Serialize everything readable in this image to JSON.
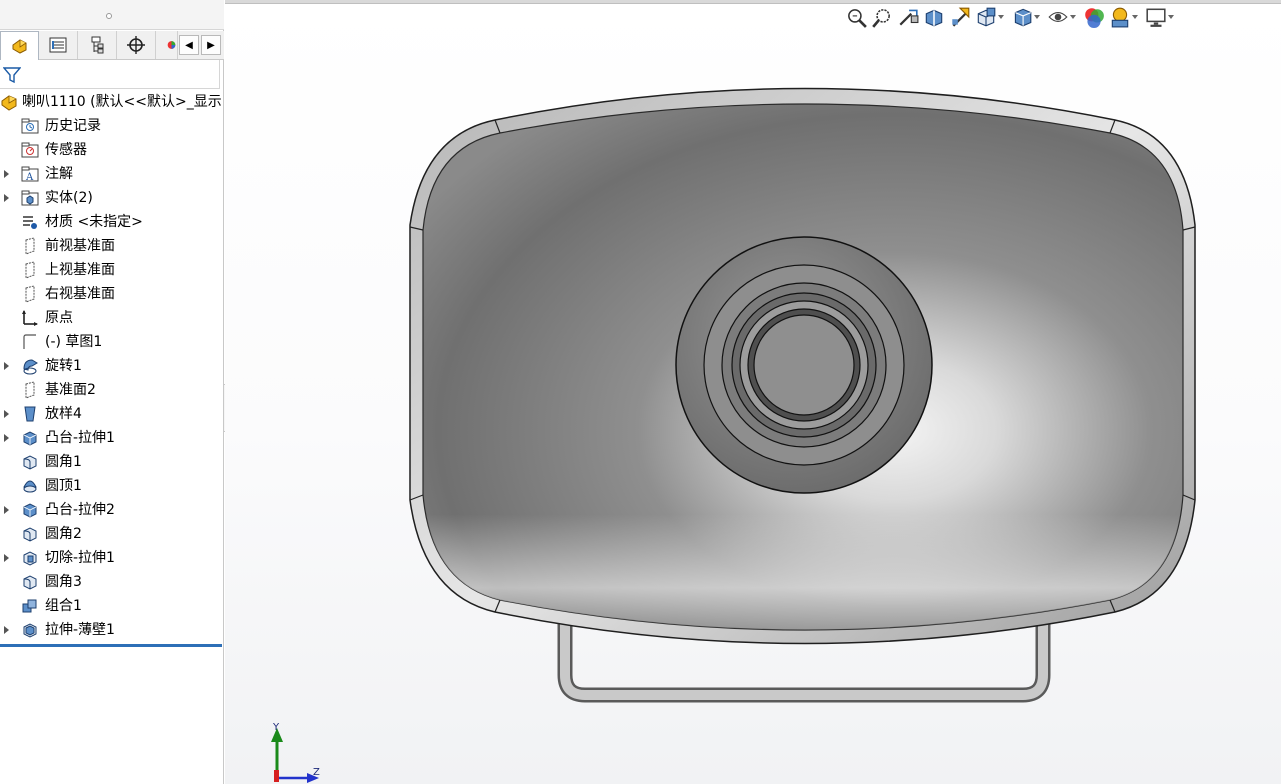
{
  "feature_tree": {
    "root": {
      "label": "喇叭1110 (默认<<默认>_显示",
      "icon": "part-icon"
    },
    "items": [
      {
        "label": "历史记录",
        "icon": "history-folder-icon",
        "expandable": false
      },
      {
        "label": "传感器",
        "icon": "sensor-folder-icon",
        "expandable": false
      },
      {
        "label": "注解",
        "icon": "annotation-folder-icon",
        "expandable": true
      },
      {
        "label": "实体(2)",
        "icon": "solid-bodies-folder-icon",
        "expandable": true
      },
      {
        "label": "材质 <未指定>",
        "icon": "material-icon",
        "expandable": false
      },
      {
        "label": "前视基准面",
        "icon": "plane-icon",
        "expandable": false
      },
      {
        "label": "上视基准面",
        "icon": "plane-icon",
        "expandable": false
      },
      {
        "label": "右视基准面",
        "icon": "plane-icon",
        "expandable": false
      },
      {
        "label": "原点",
        "icon": "origin-icon",
        "expandable": false
      },
      {
        "label": "(-) 草图1",
        "icon": "sketch-icon",
        "expandable": false
      },
      {
        "label": "旋转1",
        "icon": "revolve-icon",
        "expandable": true
      },
      {
        "label": "基准面2",
        "icon": "plane-icon",
        "expandable": false
      },
      {
        "label": "放样4",
        "icon": "loft-icon",
        "expandable": true
      },
      {
        "label": "凸台-拉伸1",
        "icon": "boss-extrude-icon",
        "expandable": true
      },
      {
        "label": "圆角1",
        "icon": "fillet-icon",
        "expandable": false
      },
      {
        "label": "圆顶1",
        "icon": "dome-icon",
        "expandable": false
      },
      {
        "label": "凸台-拉伸2",
        "icon": "boss-extrude-icon",
        "expandable": true
      },
      {
        "label": "圆角2",
        "icon": "fillet-icon",
        "expandable": false
      },
      {
        "label": "切除-拉伸1",
        "icon": "cut-extrude-icon",
        "expandable": true
      },
      {
        "label": "圆角3",
        "icon": "fillet-icon",
        "expandable": false
      },
      {
        "label": "组合1",
        "icon": "combine-icon",
        "expandable": false
      },
      {
        "label": "拉伸-薄壁1",
        "icon": "thin-extrude-icon",
        "expandable": true
      }
    ]
  },
  "panel_tabs": [
    {
      "name": "feature-manager-tab",
      "active": true
    },
    {
      "name": "property-manager-tab",
      "active": false
    },
    {
      "name": "configuration-manager-tab",
      "active": false
    },
    {
      "name": "dimxpert-manager-tab",
      "active": false
    },
    {
      "name": "display-manager-tab",
      "active": false
    }
  ],
  "heads_up_toolbar": [
    {
      "name": "zoom-to-fit-icon"
    },
    {
      "name": "zoom-to-area-icon"
    },
    {
      "name": "previous-view-icon"
    },
    {
      "name": "section-view-icon"
    },
    {
      "name": "dynamic-annotation-icon"
    },
    {
      "name": "view-orientation-icon",
      "dropdown": true
    },
    {
      "name": "display-style-icon",
      "dropdown": true
    },
    {
      "name": "hide-show-items-icon",
      "dropdown": true
    },
    {
      "name": "edit-appearance-icon"
    },
    {
      "name": "apply-scene-icon",
      "dropdown": true
    },
    {
      "name": "view-settings-icon",
      "dropdown": true
    }
  ],
  "triad": {
    "y_label": "Y",
    "z_label": "Z"
  },
  "colors": {
    "accent": "#2d6fb7",
    "selection_bar": "#2d6fb7",
    "model_gray": "#8a8a8a"
  }
}
